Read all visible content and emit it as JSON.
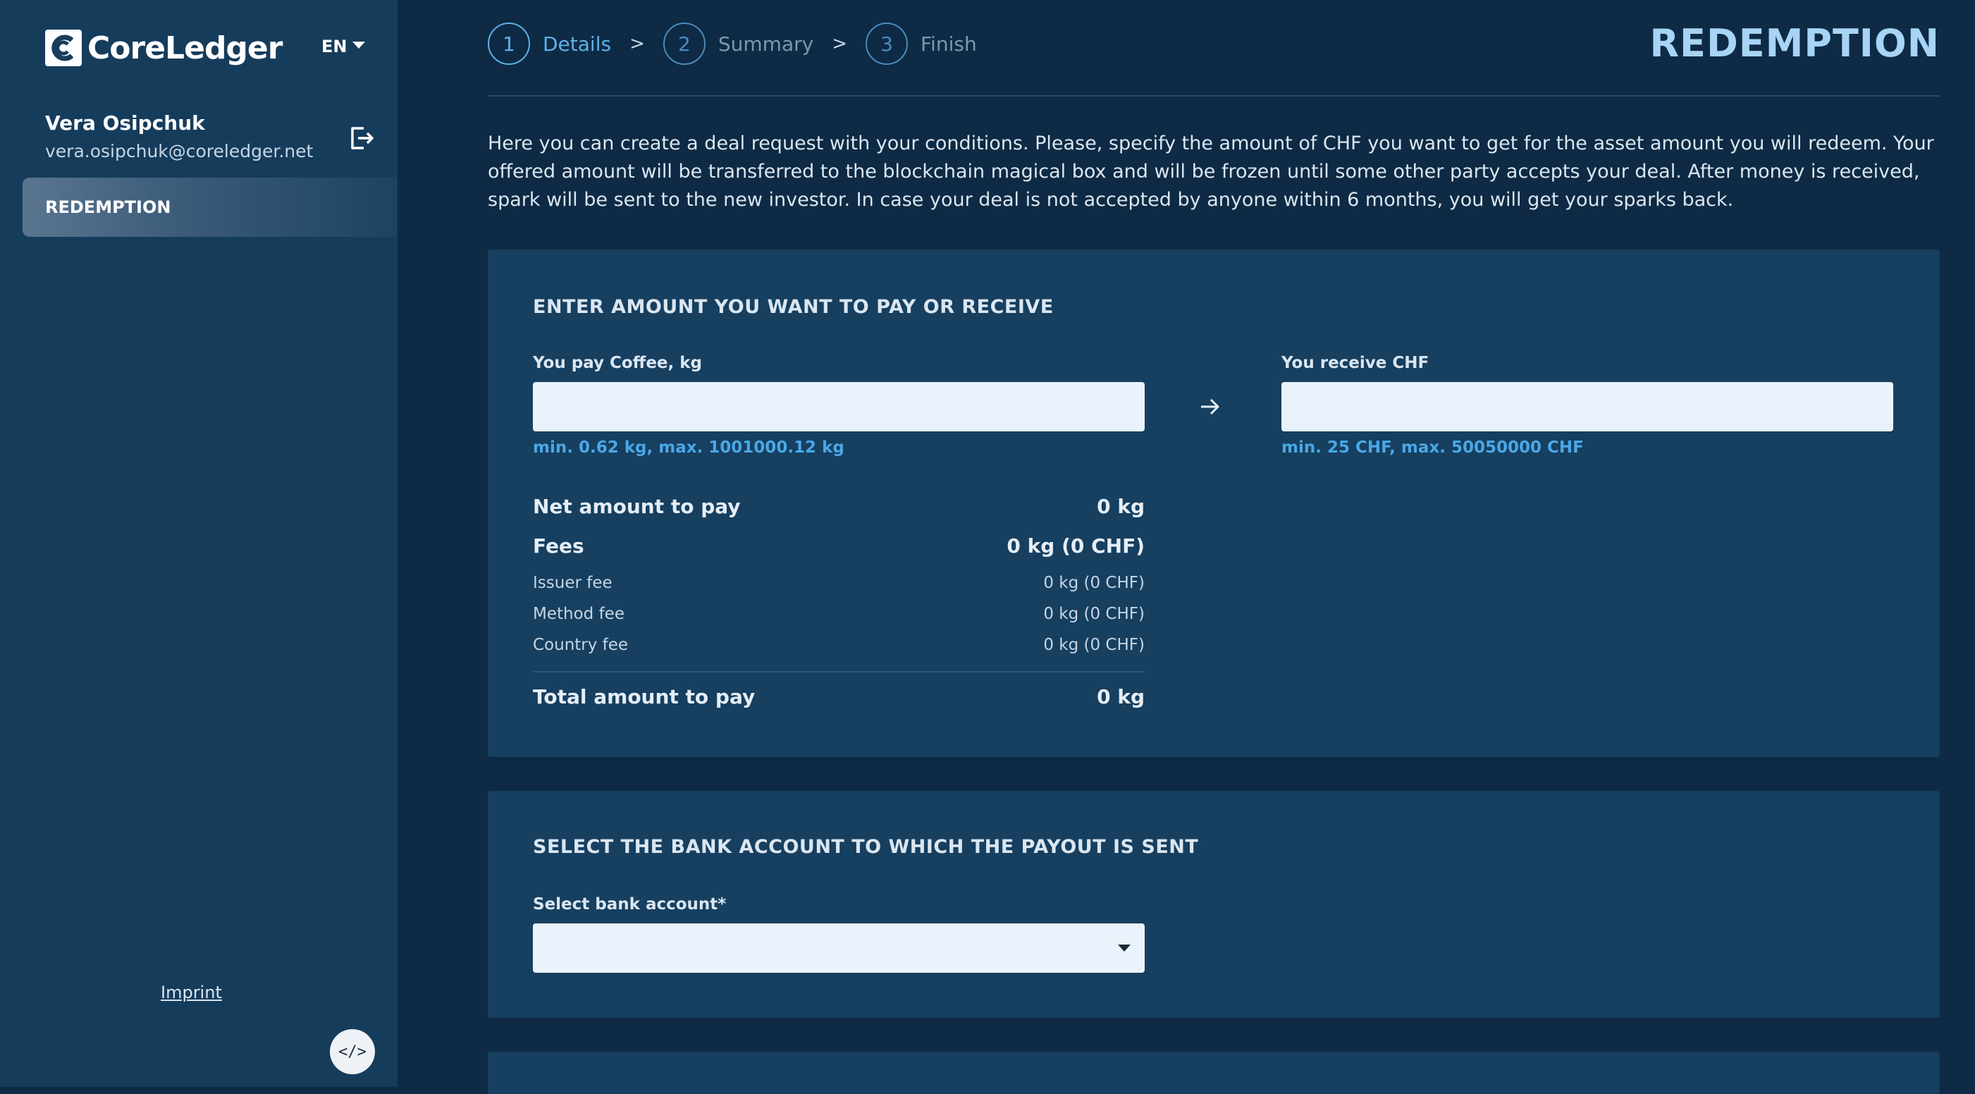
{
  "sidebar": {
    "logo_text": "CoreLedger",
    "language": "EN",
    "user": {
      "name": "Vera Osipchuk",
      "email": "vera.osipchuk@coreledger.net"
    },
    "nav": [
      {
        "label": "REDEMPTION",
        "active": true
      }
    ],
    "imprint": "Imprint",
    "dev_button": "</>"
  },
  "steps": [
    {
      "number": "1",
      "label": "Details",
      "active": true
    },
    {
      "number": "2",
      "label": "Summary",
      "active": false
    },
    {
      "number": "3",
      "label": "Finish",
      "active": false
    }
  ],
  "step_separator": ">",
  "page_title": "REDEMPTION",
  "intro": "Here you can create a deal request with your conditions. Please, specify the amount of CHF you want to get for the asset amount you will redeem. Your offered amount will be transferred to the blockchain magical box and will be frozen until some other party accepts your deal. After money is received, spark will be sent to the new investor. In case your deal is not accepted by anyone within 6 months, you will get your sparks back.",
  "amount_card": {
    "title": "ENTER AMOUNT YOU WANT TO PAY OR RECEIVE",
    "pay": {
      "label": "You pay Coffee, kg",
      "value": "",
      "hint": "min. 0.62 kg, max. 1001000.12 kg"
    },
    "receive": {
      "label": "You receive CHF",
      "value": "",
      "hint": "min. 25 CHF, max. 50050000 CHF"
    },
    "net": {
      "label": "Net amount to pay",
      "value": "0 kg"
    },
    "fees": {
      "label": "Fees",
      "value": "0 kg (0 CHF)"
    },
    "fee_items": [
      {
        "label": "Issuer fee",
        "value": "0 kg (0 CHF)"
      },
      {
        "label": "Method fee",
        "value": "0 kg (0 CHF)"
      },
      {
        "label": "Country fee",
        "value": "0 kg (0 CHF)"
      }
    ],
    "total": {
      "label": "Total amount to pay",
      "value": "0 kg"
    }
  },
  "bank_card": {
    "title": "SELECT THE BANK ACCOUNT TO WHICH THE PAYOUT IS SENT",
    "select_label": "Select bank account*",
    "selected": ""
  },
  "colors": {
    "background": "#0e2a44",
    "sidebar": "#163c5c",
    "card": "#163f60",
    "accent": "#5fb1e8",
    "title": "#a7d3f5",
    "hint": "#4aa8e6"
  }
}
